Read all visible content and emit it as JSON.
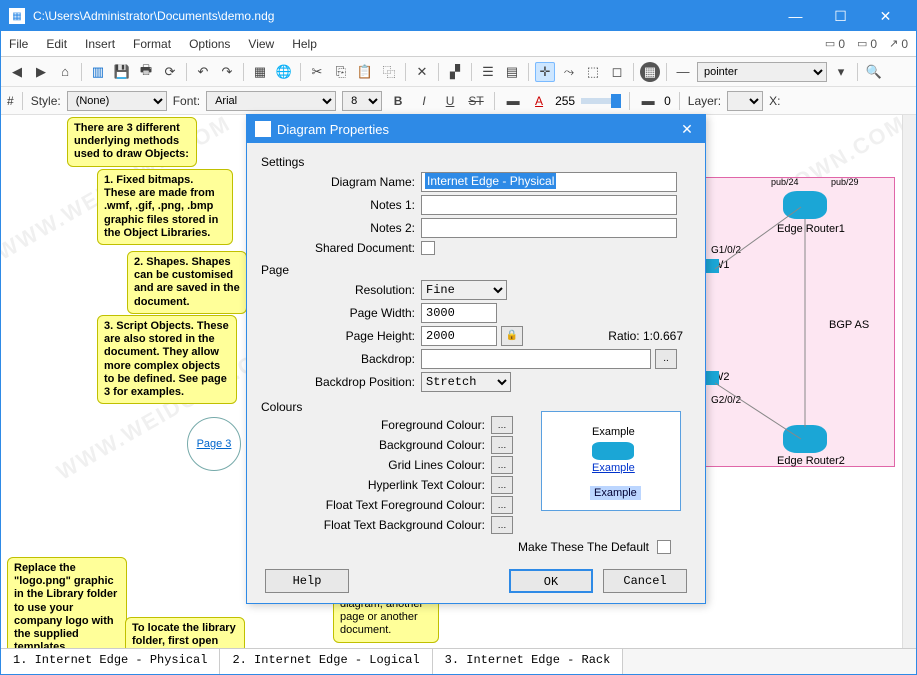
{
  "window": {
    "title": "C:\\Users\\Administrator\\Documents\\demo.ndg"
  },
  "menu": {
    "items": [
      "File",
      "Edit",
      "Insert",
      "Format",
      "Options",
      "View",
      "Help"
    ],
    "right_counts": [
      "0",
      "0",
      "0"
    ]
  },
  "toolbar2": {
    "pointer_label": "pointer"
  },
  "props": {
    "hash": "#",
    "style_label": "Style:",
    "style_value": "(None)",
    "font_label": "Font:",
    "font_value": "Arial",
    "size_value": "8",
    "opacity": "255",
    "origin": "0",
    "layer_label": "Layer:",
    "xlabel": "X:"
  },
  "notes": {
    "n1": "There are 3 different underlying methods used to draw Objects:",
    "n2": "1. Fixed bitmaps. These are made from .wmf, .gif, .png, .bmp graphic files stored in the Object Libraries.",
    "n3": "2. Shapes. Shapes can be customised and are saved in the document.",
    "n4": "3. Script Objects. These are also stored in the document. They allow more complex objects to be defined. See page 3 for examples.",
    "n5": "Replace the \"logo.png\" graphic in the Library folder to use your company logo with the supplied templates.",
    "n6": "To locate the library folder, first open",
    "n7": "diagram, another page or another document.",
    "pagelink": "Page 3"
  },
  "diagram": {
    "router1_label": "Edge Router1",
    "router2_label": "Edge Router2",
    "if1": "G1/0/2",
    "if2": "G2/0/2",
    "pub1": "pub/24",
    "pub2": "pub/29",
    "w1": "W1",
    "w2": "W2",
    "bgp": "BGP AS"
  },
  "tabs": {
    "t1": "1. Internet Edge - Physical",
    "t2": "2. Internet Edge - Logical",
    "t3": "3. Internet Edge - Rack"
  },
  "dialog": {
    "title": "Diagram Properties",
    "sections": {
      "settings": "Settings",
      "page": "Page",
      "colours": "Colours"
    },
    "labels": {
      "name": "Diagram Name:",
      "notes1": "Notes 1:",
      "notes2": "Notes 2:",
      "shared": "Shared Document:",
      "resolution": "Resolution:",
      "width": "Page Width:",
      "height": "Page Height:",
      "ratio": "Ratio: 1:0.667",
      "backdrop": "Backdrop:",
      "backdrop_pos": "Backdrop Position:",
      "fg": "Foreground Colour:",
      "bg": "Background Colour:",
      "grid": "Grid Lines Colour:",
      "hyper": "Hyperlink Text Colour:",
      "floatfg": "Float Text Foreground Colour:",
      "floatbg": "Float Text Background Colour:",
      "default": "Make These The Default"
    },
    "values": {
      "name": "Internet Edge - Physical",
      "notes1": "",
      "notes2": "",
      "resolution": "Fine",
      "width": "3000",
      "height": "2000",
      "backdrop": "",
      "backdrop_pos": "Stretch"
    },
    "preview": {
      "ex1": "Example",
      "ex2": "Example",
      "ex3": "Example"
    },
    "buttons": {
      "help": "Help",
      "ok": "OK",
      "cancel": "Cancel"
    }
  },
  "watermark": "WWW.WEIDOWN.COM"
}
